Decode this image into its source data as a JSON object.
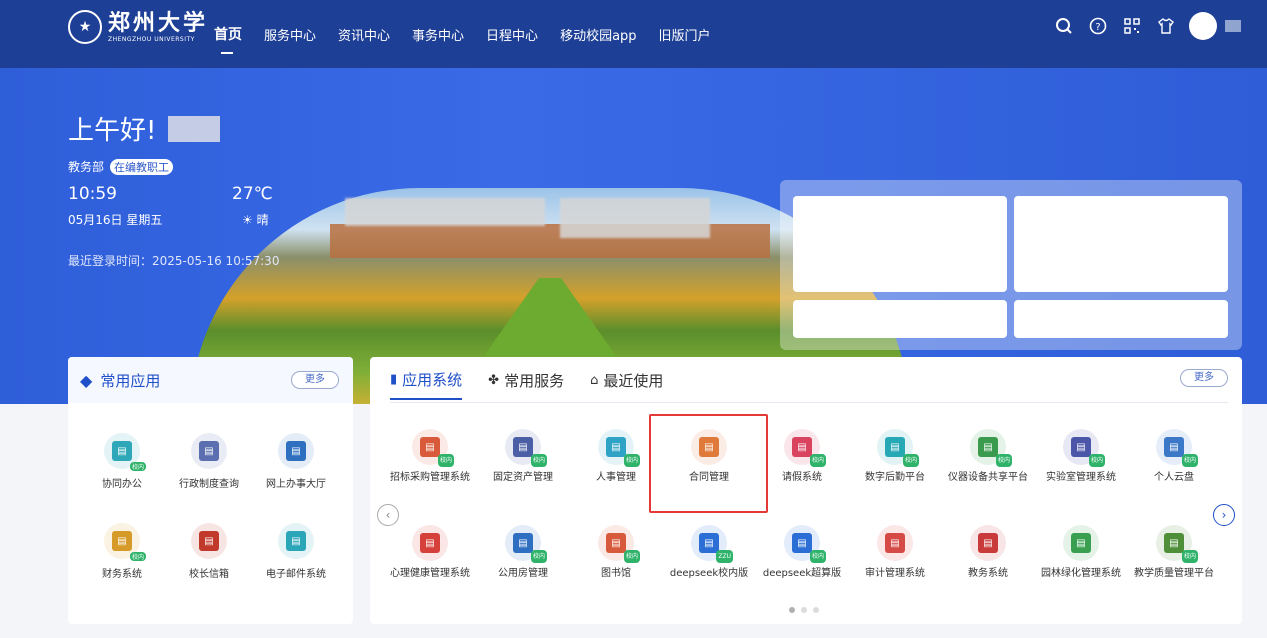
{
  "header": {
    "logo_cn": "郑州大学",
    "logo_en": "ZHENGZHOU UNIVERSITY",
    "nav": [
      "首页",
      "服务中心",
      "资讯中心",
      "事务中心",
      "日程中心",
      "移动校园app",
      "旧版门户"
    ]
  },
  "hero": {
    "greeting": "上午好!",
    "dept": "教务部",
    "badge": "在编教职工",
    "time": "10:59",
    "temperature": "27℃",
    "date": "05月16日 星期五",
    "weather": "晴",
    "last_login": "最近登录时间：2025-05-16 10:57:30"
  },
  "common_apps": {
    "title": "常用应用",
    "more": "更多",
    "items": [
      {
        "label": "协同办公",
        "color": "#2ea8b8",
        "tag": "校内"
      },
      {
        "label": "行政制度查询",
        "color": "#5b6fb0",
        "tag": ""
      },
      {
        "label": "网上办事大厅",
        "color": "#2e6fc0",
        "tag": ""
      },
      {
        "label": "财务系统",
        "color": "#d69a28",
        "tag": "校内"
      },
      {
        "label": "校长信箱",
        "color": "#c0392b",
        "tag": ""
      },
      {
        "label": "电子邮件系统",
        "color": "#2ba6b8",
        "tag": ""
      }
    ]
  },
  "app_panel": {
    "tabs": [
      "应用系统",
      "常用服务",
      "最近使用"
    ],
    "more": "更多",
    "apps": [
      {
        "label": "招标采购管理系统",
        "color": "#d95a3a",
        "tag": "校内"
      },
      {
        "label": "固定资产管理",
        "color": "#4a5fa6",
        "tag": "校内"
      },
      {
        "label": "人事管理",
        "color": "#2ea3c6",
        "tag": "校内"
      },
      {
        "label": "合同管理",
        "color": "#e07a3a",
        "tag": ""
      },
      {
        "label": "请假系统",
        "color": "#d9435f",
        "tag": "校内"
      },
      {
        "label": "数字后勤平台",
        "color": "#26a8b5",
        "tag": "校内"
      },
      {
        "label": "仪器设备共享平台",
        "color": "#3a9b4e",
        "tag": "校内"
      },
      {
        "label": "实验室管理系统",
        "color": "#4b56a8",
        "tag": "校内"
      },
      {
        "label": "个人云盘",
        "color": "#3c78c8",
        "tag": "校内"
      },
      {
        "label": "心理健康管理系统",
        "color": "#d6403a",
        "tag": ""
      },
      {
        "label": "公用房管理",
        "color": "#2f6fc2",
        "tag": "校内"
      },
      {
        "label": "图书馆",
        "color": "#d85a3c",
        "tag": "校内"
      },
      {
        "label": "deepseek校内版",
        "color": "#2b6fd6",
        "tag": "ZZU"
      },
      {
        "label": "deepseek超算版",
        "color": "#2b6fd6",
        "tag": "校内"
      },
      {
        "label": "审计管理系统",
        "color": "#d64a46",
        "tag": ""
      },
      {
        "label": "教务系统",
        "color": "#c93a3a",
        "tag": ""
      },
      {
        "label": "园林绿化管理系统",
        "color": "#3aa04f",
        "tag": ""
      },
      {
        "label": "教学质量管理平台",
        "color": "#4f8f3a",
        "tag": "校内"
      }
    ]
  }
}
